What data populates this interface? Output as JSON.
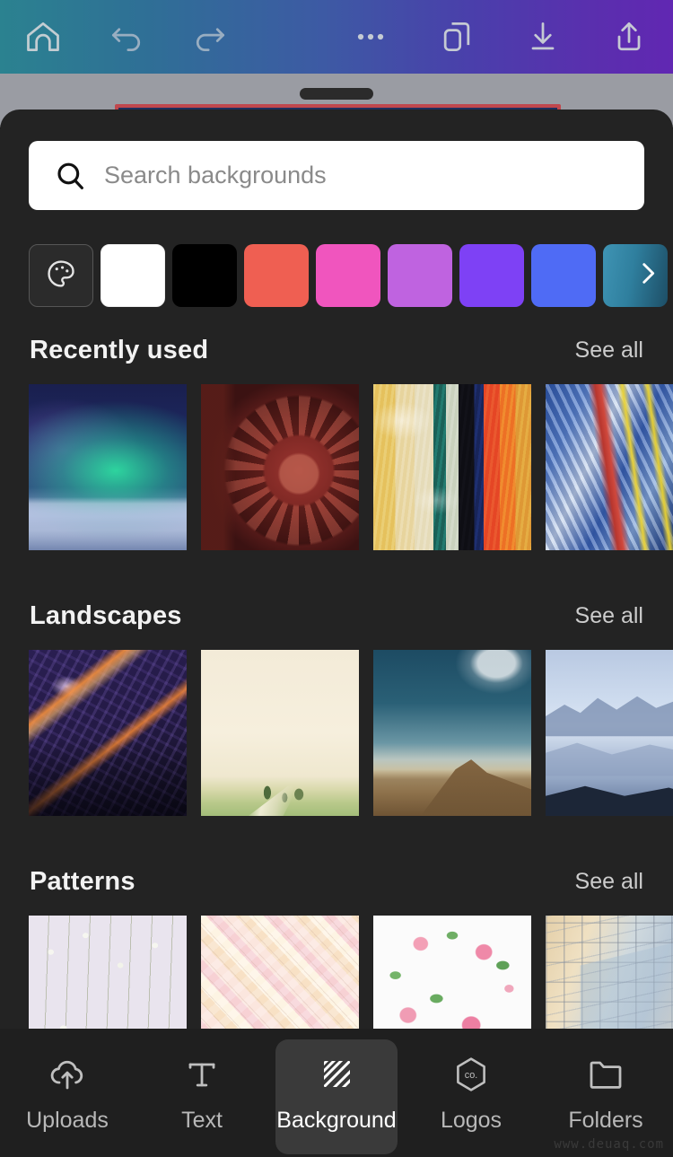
{
  "toolbar": {
    "gradient_from": "#2b8290",
    "gradient_to": "#6127b2",
    "icons": [
      {
        "name": "home-icon",
        "label": "Home"
      },
      {
        "name": "undo-icon",
        "label": "Undo"
      },
      {
        "name": "redo-icon",
        "label": "Redo"
      },
      {
        "name": "more-options-icon",
        "label": "More"
      },
      {
        "name": "duplicate-page-icon",
        "label": "Pages"
      },
      {
        "name": "download-icon",
        "label": "Download"
      },
      {
        "name": "share-icon",
        "label": "Share"
      }
    ]
  },
  "sheet": {
    "drag_handle": "drag-handle",
    "search": {
      "placeholder": "Search backgrounds",
      "value": "",
      "icon": "search-icon"
    },
    "swatches": [
      {
        "name": "color-picker",
        "color": "#2b2b2b",
        "icon": "palette-icon"
      },
      {
        "name": "swatch-white",
        "color": "#ffffff"
      },
      {
        "name": "swatch-black",
        "color": "#000000"
      },
      {
        "name": "swatch-coral",
        "color": "#ef5f52"
      },
      {
        "name": "swatch-pink",
        "color": "#f055be"
      },
      {
        "name": "swatch-orchid",
        "color": "#bf63e0"
      },
      {
        "name": "swatch-violet",
        "color": "#7e41f5"
      },
      {
        "name": "swatch-blue",
        "color": "#4f6bf5"
      },
      {
        "name": "swatch-teal",
        "color": "#3a8fb0",
        "has_more_arrow": true,
        "arrow_icon": "chevron-right-icon"
      }
    ],
    "sections": [
      {
        "title": "Recently used",
        "see_all": "See all",
        "thumbs": [
          {
            "name": "thumb-aurora",
            "alt": "Aurora over snowy mountains"
          },
          {
            "name": "thumb-gear",
            "alt": "Rusty red gear close-up"
          },
          {
            "name": "thumb-paint-texture",
            "alt": "Multicolor peeling paint texture"
          },
          {
            "name": "thumb-blue-paint",
            "alt": "Blue swirled paint abstract"
          }
        ]
      },
      {
        "title": "Landscapes",
        "see_all": "See all",
        "thumbs": [
          {
            "name": "thumb-city-night",
            "alt": "City skyline at night"
          },
          {
            "name": "thumb-foggy-field",
            "alt": "Foggy field with trees"
          },
          {
            "name": "thumb-desert",
            "alt": "Desert plateau under blue sky"
          },
          {
            "name": "thumb-misty-mountains",
            "alt": "Misty blue mountain ridges"
          }
        ]
      },
      {
        "title": "Patterns",
        "see_all": "See all",
        "thumbs": [
          {
            "name": "thumb-dried-flowers",
            "alt": "Dried white flowers on lilac"
          },
          {
            "name": "thumb-marshmallows",
            "alt": "Pastel marshmallow pile"
          },
          {
            "name": "thumb-roses",
            "alt": "Pink roses and leaves on white"
          },
          {
            "name": "thumb-glass-building",
            "alt": "Glass building facade"
          }
        ]
      }
    ]
  },
  "bottom_nav": {
    "active": "Background",
    "items": [
      {
        "label": "Uploads",
        "icon": "cloud-upload-icon",
        "active": false
      },
      {
        "label": "Text",
        "icon": "text-t-icon",
        "active": false
      },
      {
        "label": "Background",
        "icon": "hatch-pattern-icon",
        "active": true
      },
      {
        "label": "Logos",
        "icon": "company-hexagon-icon",
        "active": false
      },
      {
        "label": "Folders",
        "icon": "folder-icon",
        "active": false
      }
    ]
  },
  "watermark": "www.deuaq.com"
}
